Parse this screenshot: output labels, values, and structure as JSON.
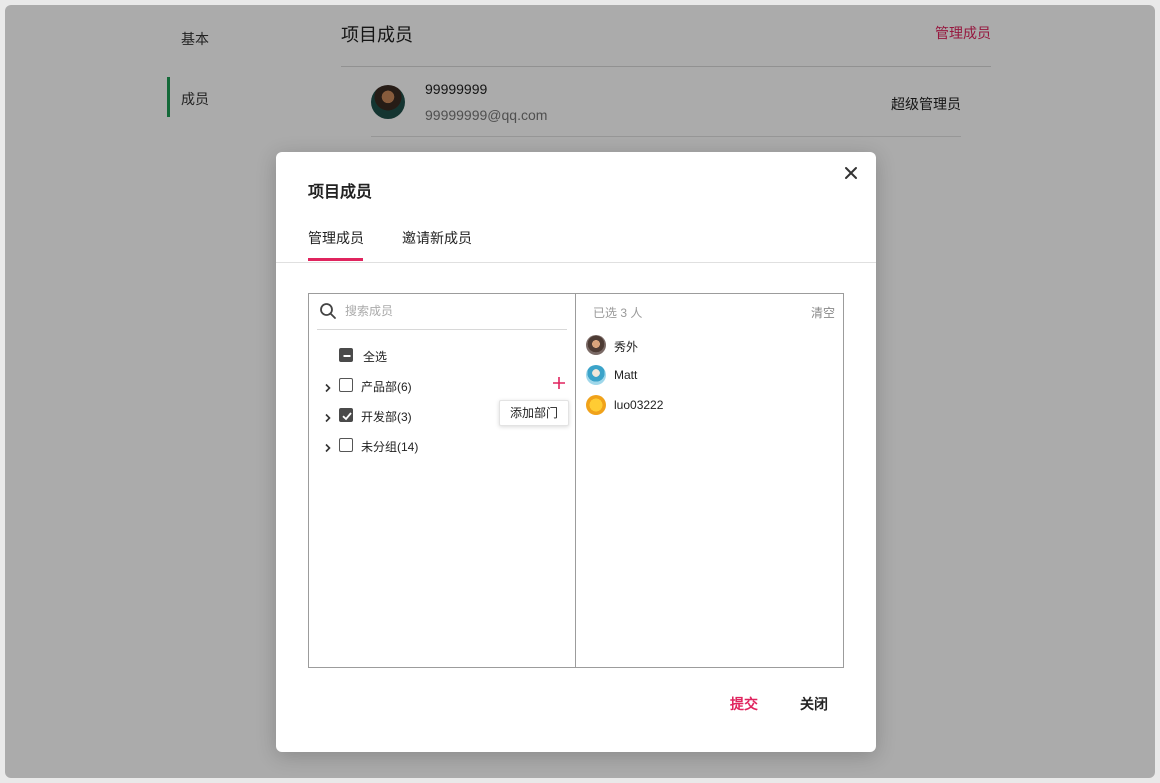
{
  "background": {
    "nav": [
      {
        "label": "基本"
      },
      {
        "label": "成员"
      }
    ],
    "page_title": "项目成员",
    "manage_link": "管理成员",
    "member": {
      "name": "99999999",
      "email": "99999999@qq.com",
      "role": "超级管理员"
    }
  },
  "colors": {
    "accent": "#e0245e",
    "nav_active": "#1f9d55"
  },
  "modal": {
    "title": "项目成员",
    "tabs": [
      {
        "label": "管理成员",
        "active": true
      },
      {
        "label": "邀请新成员",
        "active": false
      }
    ],
    "search": {
      "placeholder": "搜索成员",
      "value": ""
    },
    "select_all": "全选",
    "departments": [
      {
        "label": "产品部(6)",
        "checked": false
      },
      {
        "label": "开发部(3)",
        "checked": true
      },
      {
        "label": "未分组(14)",
        "checked": false
      }
    ],
    "add_department_tooltip": "添加部门",
    "selected_count": "已选 3 人",
    "clear": "清空",
    "selected": [
      {
        "name": "秀外"
      },
      {
        "name": "Matt"
      },
      {
        "name": "luo03222"
      }
    ],
    "submit": "提交",
    "cancel": "关闭"
  }
}
